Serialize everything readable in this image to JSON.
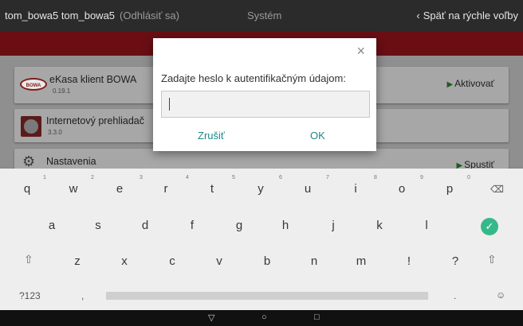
{
  "topbar": {
    "user": "tom_bowa5 tom_bowa5",
    "logout": "(Odhlásiť sa)",
    "title": "Systém",
    "back": "Späť na rýchle voľby",
    "back_icon": "‹"
  },
  "apps": [
    {
      "name": "eKasa klient BOWA",
      "version": "0.19.1",
      "action": "Aktivovať",
      "icon": "BOWA"
    },
    {
      "name": "Internetový prehliadač",
      "version": "3.3.0"
    },
    {
      "name": "Nastavenia",
      "action": "Spustiť"
    }
  ],
  "dialog": {
    "close": "×",
    "prompt": "Zadajte heslo k autentifikačným údajom:",
    "input_value": "",
    "cancel": "Zrušiť",
    "ok": "OK"
  },
  "keyboard": {
    "row1": [
      "q",
      "w",
      "e",
      "r",
      "t",
      "y",
      "u",
      "i",
      "o",
      "p"
    ],
    "row1_hints": [
      "1",
      "2",
      "3",
      "4",
      "5",
      "6",
      "7",
      "8",
      "9",
      "0"
    ],
    "row2": [
      "a",
      "s",
      "d",
      "f",
      "g",
      "h",
      "j",
      "k",
      "l"
    ],
    "row3": [
      "z",
      "x",
      "c",
      "v",
      "b",
      "n",
      "m",
      "!",
      "?"
    ],
    "backspace": "⌫",
    "enter": "✓",
    "shift": "⇧",
    "symbols": "?123",
    "comma": ",",
    "period": ".",
    "emoji": "☺"
  },
  "navbar": {
    "back": "▽",
    "home": "○",
    "recents": "□"
  },
  "colors": {
    "accent": "#1a8a87",
    "enter_key": "#36b98a",
    "red_band": "#6a0e14"
  }
}
